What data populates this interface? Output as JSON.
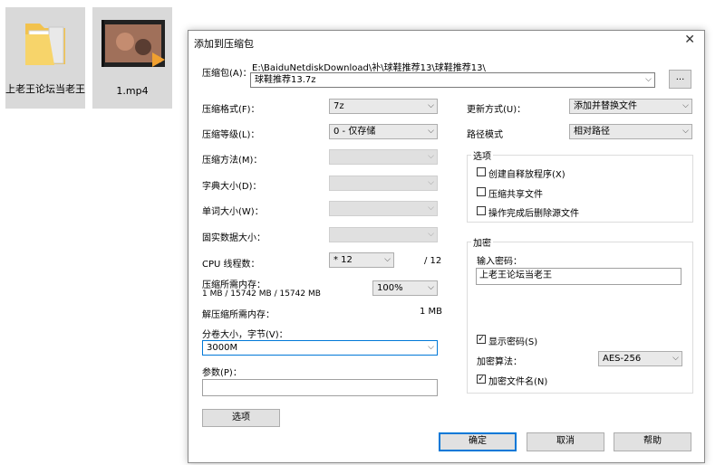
{
  "desktop": {
    "folder_label": "上老王论坛当老王",
    "video_label": "1.mp4"
  },
  "dialog": {
    "title": "添加到压缩包",
    "close_icon": "close-icon",
    "archive_label": "压缩包(A)：",
    "archive_path": "E:\\BaiduNetdiskDownload\\补\\球鞋推荐13\\球鞋推荐13\\",
    "archive_name": "球鞋推荐13.7z",
    "browse_label": "...",
    "format_label": "压缩格式(F)：",
    "format_value": "7z",
    "level_label": "压缩等级(L)：",
    "level_value": "0 - 仅存储",
    "method_label": "压缩方法(M)：",
    "dict_label": "字典大小(D)：",
    "word_label": "单词大小(W)：",
    "solid_label": "固实数据大小：",
    "cpu_label": "CPU 线程数：",
    "cpu_value": "* 12",
    "cpu_total": "/ 12",
    "mem_comp_label": "压缩所需内存：",
    "mem_comp_detail": "1 MB / 15742 MB / 15742 MB",
    "mem_percent": "100%",
    "mem_decomp_label": "解压缩所需内存：",
    "mem_decomp_value": "1 MB",
    "split_label": "分卷大小，字节(V)：",
    "split_value": "3000M",
    "params_label": "参数(P)：",
    "params_value": "",
    "options_button": "选项",
    "update_label": "更新方式(U)：",
    "update_value": "添加并替换文件",
    "path_label": "路径模式",
    "path_value": "相对路径",
    "options_group": "选项",
    "opt_sfx": "创建自释放程序(X)",
    "opt_shared": "压缩共享文件",
    "opt_delete": "操作完成后删除源文件",
    "encrypt_group": "加密",
    "password_label": "输入密码：",
    "password_value": "上老王论坛当老王",
    "show_password": "显示密码(S)",
    "enc_method_label": "加密算法：",
    "enc_method_value": "AES-256",
    "enc_names": "加密文件名(N)",
    "ok_button": "确定",
    "cancel_button": "取消",
    "help_button": "帮助"
  }
}
